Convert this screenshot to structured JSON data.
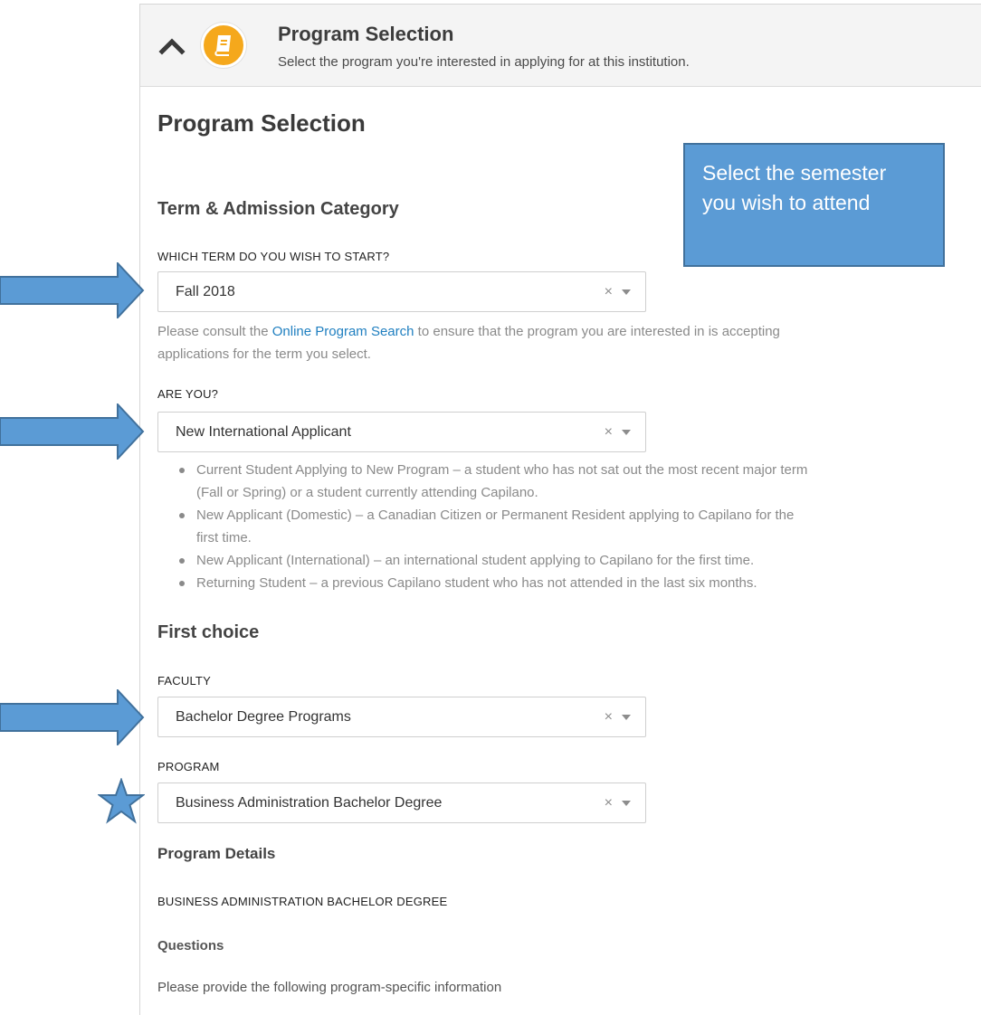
{
  "header": {
    "title": "Program Selection",
    "subtitle": "Select the program you're interested in applying for at this institution."
  },
  "page_title": "Program Selection",
  "callout": {
    "line1": "Select the semester",
    "line2": "you wish to attend"
  },
  "term_section": {
    "heading": "Term & Admission Category",
    "term_label": "WHICH TERM DO YOU WISH TO START?",
    "term_value": "Fall 2018",
    "help_prefix": "Please consult the",
    "help_link": "Online Program Search",
    "help_suffix": "to ensure that the program you are interested in is accepting",
    "help_line2": "applications for the term you select.",
    "are_you_label": "ARE YOU?",
    "are_you_value": "New International Applicant",
    "bullets": [
      {
        "l1": "Current Student Applying to New Program – a student who has not sat out the most recent major term",
        "l2": "(Fall or Spring) or a student currently attending Capilano."
      },
      {
        "l1": "New Applicant (Domestic) – a Canadian Citizen or Permanent Resident applying to Capilano for the",
        "l2": "first time."
      },
      {
        "l1": "New Applicant (International) – an international student applying to Capilano for the first time.",
        "l2": ""
      },
      {
        "l1": "Returning Student – a previous Capilano student who has not attended in the last six months.",
        "l2": ""
      }
    ]
  },
  "first_choice": {
    "heading": "First choice",
    "faculty_label": "FACULTY",
    "faculty_value": "Bachelor Degree Programs",
    "program_label": "PROGRAM",
    "program_value": "Business Administration Bachelor Degree"
  },
  "program_details": {
    "heading": "Program Details",
    "program_name": "BUSINESS ADMINISTRATION BACHELOR DEGREE",
    "questions_heading": "Questions",
    "questions_text": "Please provide the following program-specific information"
  },
  "select_clear_glyph": "×",
  "colors": {
    "badge": "#f5a81c",
    "annotation_blue": "#5b9bd5",
    "annotation_border": "#41719c",
    "link": "#1f7fc0"
  }
}
